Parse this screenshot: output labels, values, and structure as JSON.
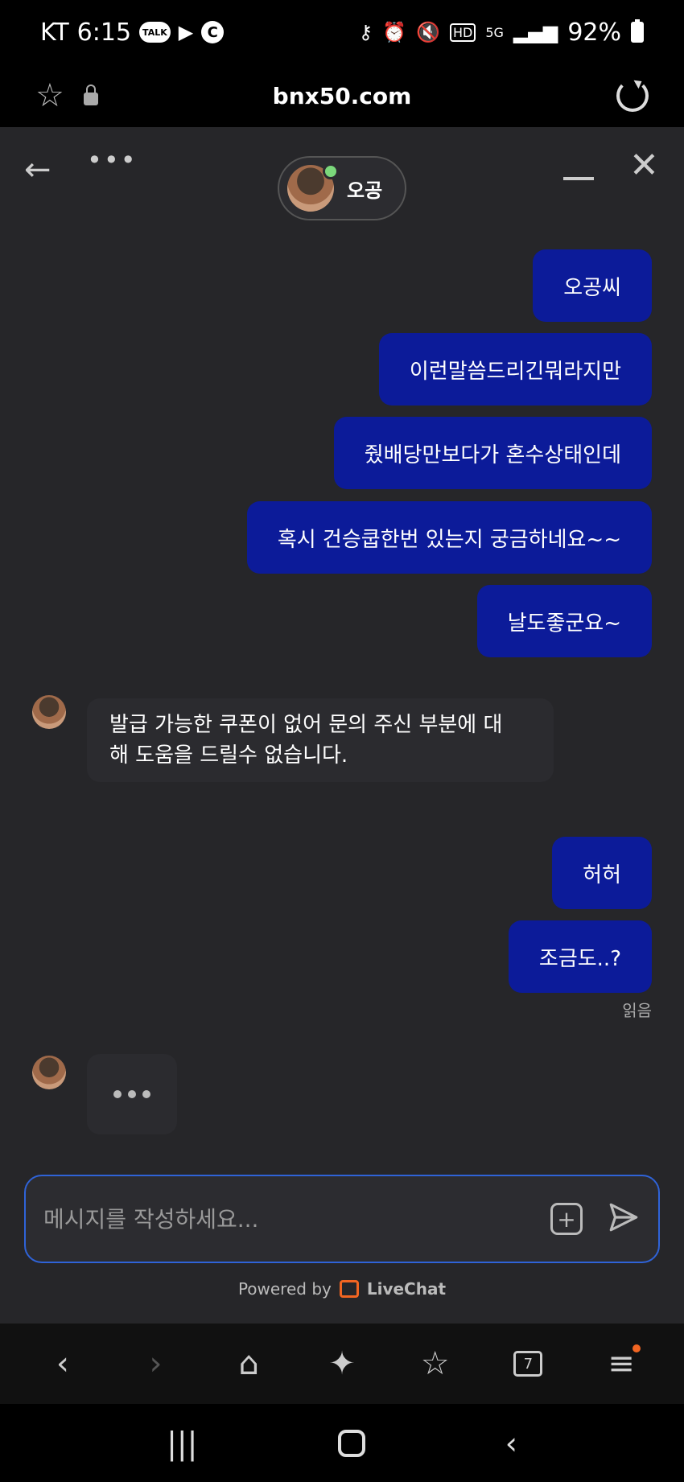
{
  "status_bar": {
    "carrier": "KT",
    "time": "6:15",
    "talk_badge": "TALK",
    "c_badge": "C",
    "network": "5G",
    "hd": "HD",
    "battery": "92%"
  },
  "browser": {
    "url": "bnx50.com"
  },
  "chat": {
    "agent_name": "오공",
    "messages_out": [
      "오공씨",
      "이런말씀드리긴뭐라지만",
      "줬배당만보다가 혼수상태인데",
      "혹시 건승쿱한번 있는지 궁금하네요~~",
      "날도좋군요~"
    ],
    "message_in_1_line1": "발급 가능한 쿠폰이 없어 문의 주신 부분에 대",
    "message_in_1_line2": "해 도움을 드릴수 없습니다.",
    "messages_out_2": [
      "허허",
      "조금도..?"
    ],
    "read_receipt": "읽음",
    "composer_placeholder": "메시지를 작성하세요...",
    "powered_prefix": "Powered by",
    "powered_brand": "LiveChat"
  },
  "toolbar": {
    "tabs_count": "7"
  },
  "colors": {
    "outgoing_bubble": "#0c1b99",
    "incoming_bubble": "#2b2b2f",
    "chat_background": "#262629",
    "composer_border": "#2f63d8",
    "livechat_orange": "#f26522",
    "online_green": "#7bd87b"
  }
}
